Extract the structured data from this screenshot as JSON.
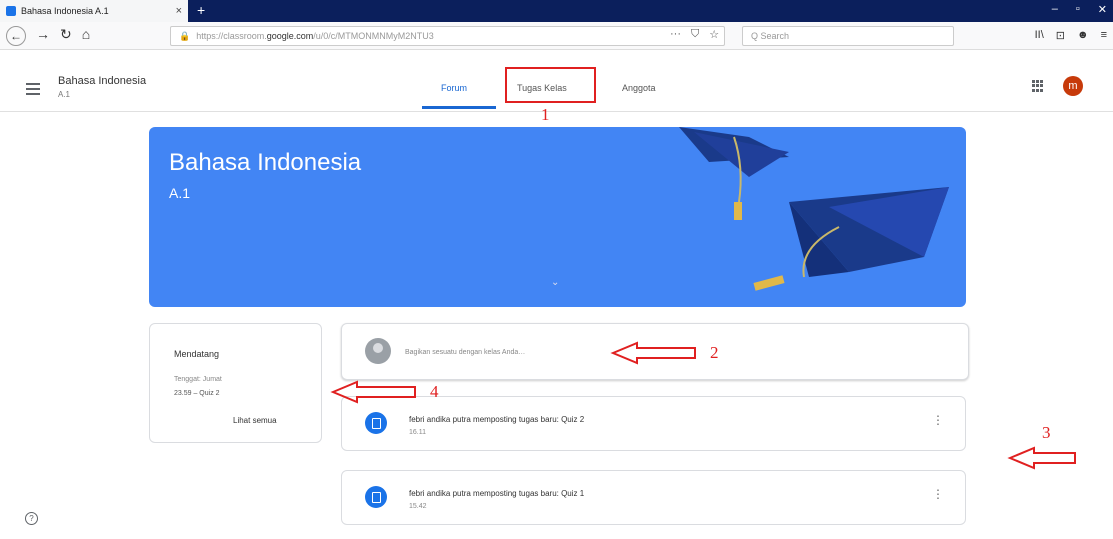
{
  "browser": {
    "tab_title": "Bahasa Indonesia A.1",
    "tab_close": "×",
    "new_tab": "+",
    "window_buttons": [
      "–",
      "▫",
      "✕"
    ],
    "url_prefix": "https://classroom.",
    "url_host": "google.com",
    "url_suffix": "/u/0/c/MTMONMNMyM2NTU3",
    "url_actions": [
      "···",
      "⛉",
      "☆"
    ],
    "search_placeholder": "Q Search",
    "right_actions": [
      "II\\",
      "⊡",
      "☻",
      "≡"
    ]
  },
  "app": {
    "class_name": "Bahasa Indonesia",
    "class_section": "A.1",
    "tabs": [
      "Forum",
      "Tugas Kelas",
      "Anggota"
    ],
    "active_tab": "Forum",
    "avatar_letter": "m"
  },
  "banner": {
    "title": "Bahasa Indonesia",
    "subtitle": "A.1",
    "expand": "⌄",
    "color": "#4285f4"
  },
  "upcoming": {
    "title": "Mendatang",
    "due_label": "Tenggat: Jumat",
    "item": "23.59 – Quiz 2",
    "view_all": "Lihat semua"
  },
  "share": {
    "placeholder": "Bagikan sesuatu dengan kelas Anda…"
  },
  "posts": [
    {
      "title": "febri andika putra memposting tugas baru: Quiz 2",
      "time": "16.11"
    },
    {
      "title": "febri andika putra memposting tugas baru: Quiz 1",
      "time": "15.42"
    }
  ],
  "annotations": {
    "labels": [
      "1",
      "2",
      "3",
      "4"
    ],
    "color": "#e02020"
  }
}
